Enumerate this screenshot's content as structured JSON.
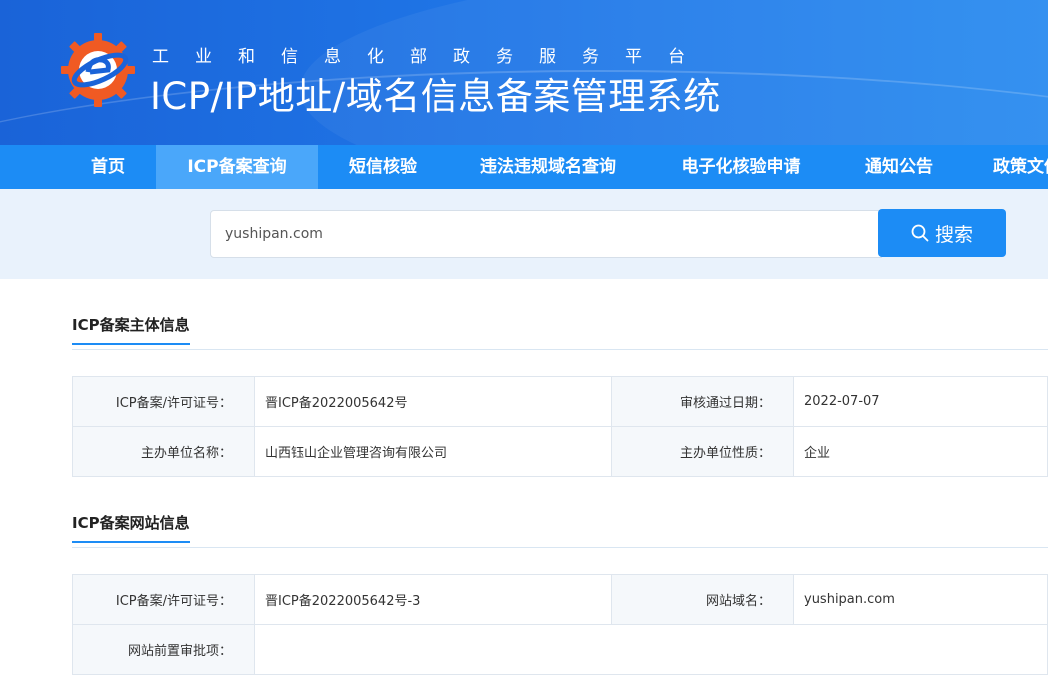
{
  "header": {
    "subtitle": "工业和信息化部政务服务平台",
    "title": "ICP/IP地址/域名信息备案管理系统"
  },
  "nav": {
    "items": [
      {
        "label": "首页"
      },
      {
        "label": "ICP备案查询",
        "active": true
      },
      {
        "label": "短信核验"
      },
      {
        "label": "违法违规域名查询"
      },
      {
        "label": "电子化核验申请"
      },
      {
        "label": "通知公告"
      },
      {
        "label": "政策文件"
      }
    ]
  },
  "search": {
    "value": "yushipan.com",
    "button_label": "搜索",
    "button_icon": "search-icon"
  },
  "entity_section": {
    "heading": "ICP备案主体信息",
    "rows": [
      {
        "label1": "ICP备案/许可证号：",
        "value1": "晋ICP备2022005642号",
        "label2": "审核通过日期：",
        "value2": "2022-07-07"
      },
      {
        "label1": "主办单位名称：",
        "value1": "山西钰山企业管理咨询有限公司",
        "label2": "主办单位性质：",
        "value2": "企业"
      }
    ]
  },
  "website_section": {
    "heading": "ICP备案网站信息",
    "rows": [
      {
        "label1": "ICP备案/许可证号：",
        "value1": "晋ICP备2022005642号-3",
        "label2": "网站域名：",
        "value2": "yushipan.com"
      },
      {
        "label1": "网站前置审批项：",
        "value1": ""
      }
    ]
  },
  "colors": {
    "brand_blue": "#1c8cf5",
    "nav_active": "#4aa7fa",
    "search_band": "#e9f2fc",
    "logo_orange": "#f05a23"
  }
}
